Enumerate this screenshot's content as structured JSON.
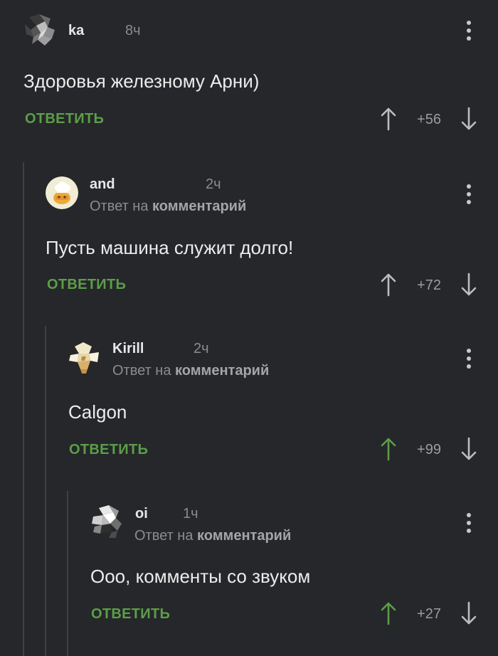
{
  "colors": {
    "background": "#25272a",
    "reply_green": "#5c9e48",
    "upvote_active": "#5c9e48",
    "vote_neutral": "#bdbdbd",
    "thread_line": "#3e4044"
  },
  "comments": [
    {
      "author": "ka",
      "time": "8ч",
      "text": "Здоровья железному Арни)",
      "reply_label": "ОТВЕТИТЬ",
      "rating": "+56",
      "upvoted": false
    },
    {
      "author": "and",
      "time": "2ч",
      "reply_prefix": "Ответ на",
      "reply_target": "комментарий",
      "text": "Пусть машина служит долго!",
      "reply_label": "ОТВЕТИТЬ",
      "rating": "+72",
      "upvoted": false
    },
    {
      "author": "Kirill",
      "time": "2ч",
      "reply_prefix": "Ответ на",
      "reply_target": "комментарий",
      "text": "Calgon",
      "reply_label": "ОТВЕТИТЬ",
      "rating": "+99",
      "upvoted": true
    },
    {
      "author": "oi",
      "time": "1ч",
      "reply_prefix": "Ответ на",
      "reply_target": "комментарий",
      "text": "Ооо, комменты со звуком",
      "reply_label": "ОТВЕТИТЬ",
      "rating": "+27",
      "upvoted": true
    }
  ]
}
